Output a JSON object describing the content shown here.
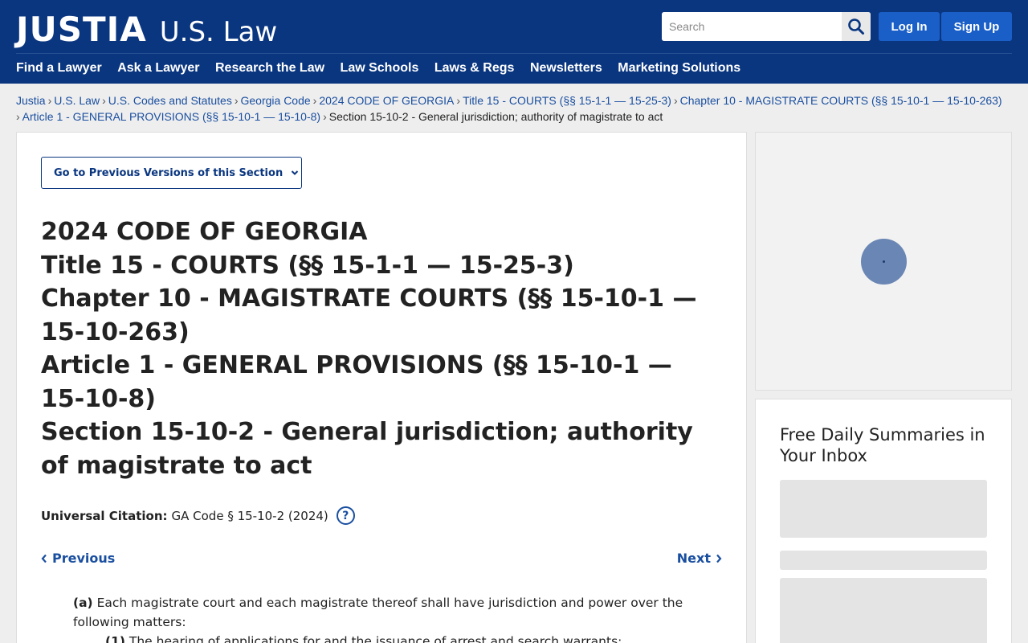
{
  "header": {
    "logo_main": "JUSTIA",
    "logo_sub": "U.S. Law",
    "search_placeholder": "Search",
    "login_label": "Log In",
    "signup_label": "Sign Up",
    "nav": [
      "Find a Lawyer",
      "Ask a Lawyer",
      "Research the Law",
      "Law Schools",
      "Laws & Regs",
      "Newsletters",
      "Marketing Solutions"
    ]
  },
  "breadcrumb": {
    "links": [
      "Justia",
      "U.S. Law",
      "U.S. Codes and Statutes",
      "Georgia Code",
      "2024 CODE OF GEORGIA",
      "Title 15 - COURTS (§§ 15-1-1 — 15-25-3)",
      "Chapter 10 - MAGISTRATE COURTS (§§ 15-10-1 — 15-10-263)",
      "Article 1 - GENERAL PROVISIONS (§§ 15-10-1 — 15-10-8)"
    ],
    "current": "Section 15-10-2 - General jurisdiction; authority of magistrate to act",
    "separator": "›"
  },
  "main": {
    "versions_button": "Go to Previous Versions of this Section",
    "titles": [
      "2024 CODE OF GEORGIA",
      "Title 15 - COURTS (§§ 15-1-1 — 15-25-3)",
      "Chapter 10 - MAGISTRATE COURTS (§§ 15-10-1 — 15-10-263)",
      "Article 1 - GENERAL PROVISIONS (§§ 15-10-1 — 15-10-8)",
      "Section 15-10-2 - General jurisdiction; authority of magistrate to act"
    ],
    "citation_label": "Universal Citation:",
    "citation_value": "GA Code § 15-10-2 (2024)",
    "help_glyph": "?",
    "prev_label": "Previous",
    "next_label": "Next",
    "para_a_marker": "(a)",
    "para_a_text": "Each magistrate court and each magistrate thereof shall have jurisdiction and power over the following matters:",
    "para_1_marker": "(1)",
    "para_1_text": "The hearing of applications for and the issuance of arrest and search warrants;"
  },
  "sidebar": {
    "newsletter_title": "Free Daily Summaries in Your Inbox"
  },
  "colors": {
    "header_bg": "#0a3680",
    "button_blue": "#1a5fc8",
    "link_blue": "#1a4fa0"
  }
}
